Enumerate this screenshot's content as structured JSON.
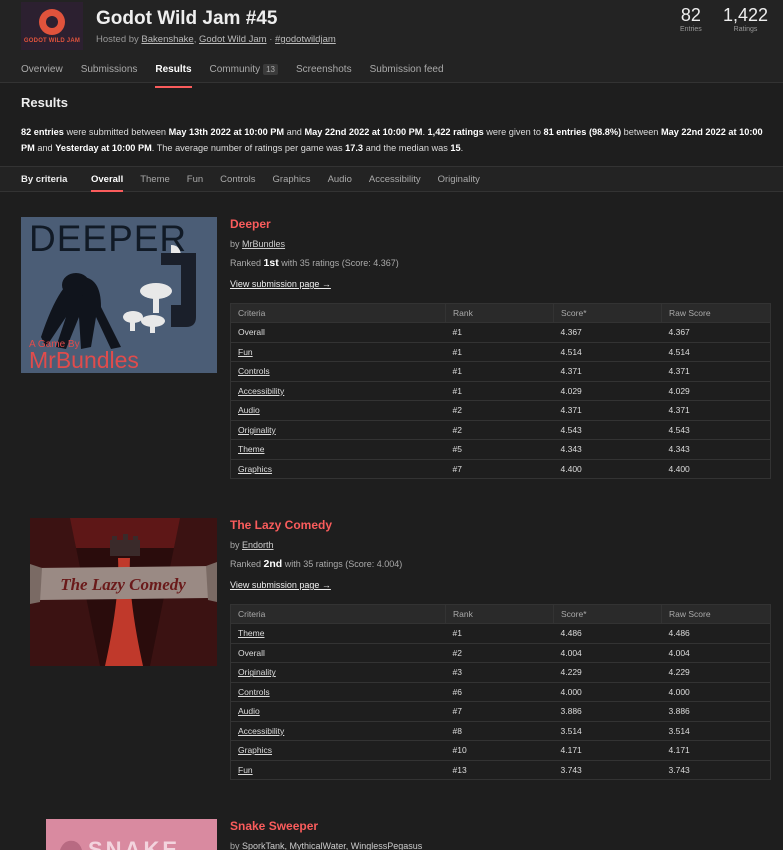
{
  "jam": {
    "title": "Godot Wild Jam #45",
    "logo_text": "GODOT WILD JAM",
    "hosted_prefix": "Hosted by ",
    "host1": "Bakenshake",
    "sep1": ", ",
    "host2": "Godot Wild Jam",
    "sep2": " · ",
    "hashtag": "#godotwildjam",
    "entries_count": "82",
    "entries_label": "Entries",
    "ratings_count": "1,422",
    "ratings_label": "Ratings"
  },
  "tabs": [
    {
      "label": "Overview"
    },
    {
      "label": "Submissions"
    },
    {
      "label": "Results"
    },
    {
      "label": "Community",
      "badge": "13"
    },
    {
      "label": "Screenshots"
    },
    {
      "label": "Submission feed"
    }
  ],
  "results": {
    "heading": "Results",
    "s1": "82 entries",
    "s2": " were submitted between ",
    "s3": "May 13th 2022 at 10:00 PM",
    "s4": " and ",
    "s5": "May 22nd 2022 at 10:00 PM",
    "s6": ". ",
    "s7": "1,422 ratings",
    "s8": " were given to ",
    "s9": "81 entries (98.8%)",
    "s10": " between ",
    "s11": "May 22nd 2022 at 10:00 PM",
    "s12": " and ",
    "s13": "Yesterday at 10:00 PM",
    "s14": ". The average number of ratings per game was ",
    "s15": "17.3",
    "s16": " and the median was ",
    "s17": "15",
    "s18": "."
  },
  "criteria_bar": {
    "label": "By criteria",
    "tabs": [
      "Overall",
      "Theme",
      "Fun",
      "Controls",
      "Graphics",
      "Audio",
      "Accessibility",
      "Originality"
    ]
  },
  "table_headers": {
    "criteria": "Criteria",
    "rank": "Rank",
    "score": "Score*",
    "raw": "Raw Score"
  },
  "games": [
    {
      "title": "Deeper",
      "by_prefix": "by ",
      "author": "MrBundles",
      "ranked_prefix": "Ranked ",
      "rank": "1st",
      "ranked_suffix": " with 35 ratings (Score: 4.367)",
      "view_link": "View submission page →",
      "thumb_text1": "DEEPER",
      "thumb_text2": "A Game By",
      "thumb_text3": "MrBundles",
      "rows": [
        {
          "criteria": "Overall",
          "rank": "#1",
          "score": "4.367",
          "raw": "4.367"
        },
        {
          "criteria": "Fun",
          "rank": "#1",
          "score": "4.514",
          "raw": "4.514"
        },
        {
          "criteria": "Controls",
          "rank": "#1",
          "score": "4.371",
          "raw": "4.371"
        },
        {
          "criteria": "Accessibility",
          "rank": "#1",
          "score": "4.029",
          "raw": "4.029"
        },
        {
          "criteria": "Audio",
          "rank": "#2",
          "score": "4.371",
          "raw": "4.371"
        },
        {
          "criteria": "Originality",
          "rank": "#2",
          "score": "4.543",
          "raw": "4.543"
        },
        {
          "criteria": "Theme",
          "rank": "#5",
          "score": "4.343",
          "raw": "4.343"
        },
        {
          "criteria": "Graphics",
          "rank": "#7",
          "score": "4.400",
          "raw": "4.400"
        }
      ]
    },
    {
      "title": "The Lazy Comedy",
      "by_prefix": "by ",
      "author": "Endorth",
      "ranked_prefix": "Ranked ",
      "rank": "2nd",
      "ranked_suffix": " with 35 ratings (Score: 4.004)",
      "view_link": "View submission page →",
      "thumb_text1": "The Lazy Comedy",
      "rows": [
        {
          "criteria": "Theme",
          "rank": "#1",
          "score": "4.486",
          "raw": "4.486"
        },
        {
          "criteria": "Overall",
          "rank": "#2",
          "score": "4.004",
          "raw": "4.004"
        },
        {
          "criteria": "Originality",
          "rank": "#3",
          "score": "4.229",
          "raw": "4.229"
        },
        {
          "criteria": "Controls",
          "rank": "#6",
          "score": "4.000",
          "raw": "4.000"
        },
        {
          "criteria": "Audio",
          "rank": "#7",
          "score": "3.886",
          "raw": "3.886"
        },
        {
          "criteria": "Accessibility",
          "rank": "#8",
          "score": "3.514",
          "raw": "3.514"
        },
        {
          "criteria": "Graphics",
          "rank": "#10",
          "score": "4.171",
          "raw": "4.171"
        },
        {
          "criteria": "Fun",
          "rank": "#13",
          "score": "3.743",
          "raw": "3.743"
        }
      ]
    },
    {
      "title": "Snake Sweeper",
      "by_prefix": "by ",
      "author": "SporkTank, MythicalWater, WinglessPegasus",
      "thumb_text1": "SNAKE"
    }
  ],
  "colors": {
    "accent": "#fa5c5c",
    "background": "#1e1e1e",
    "header": "#232323"
  }
}
